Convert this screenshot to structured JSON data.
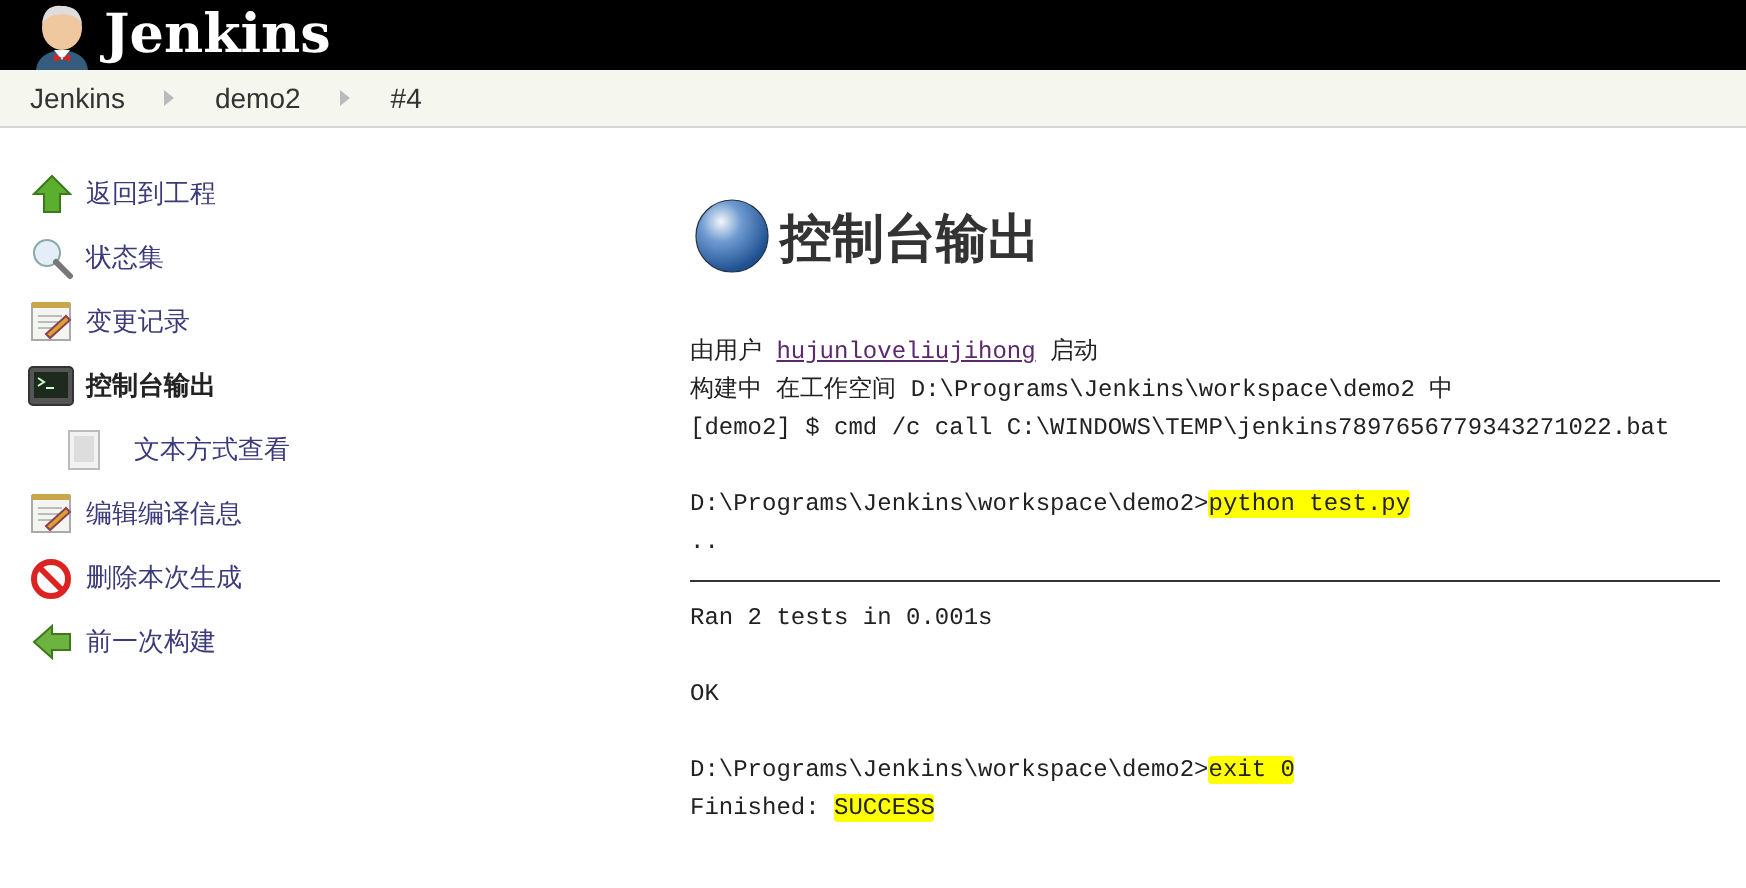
{
  "header": {
    "title": "Jenkins"
  },
  "breadcrumbs": [
    {
      "label": "Jenkins"
    },
    {
      "label": "demo2"
    },
    {
      "label": "#4"
    }
  ],
  "sidebar": {
    "items": [
      {
        "label": "返回到工程",
        "kind": "up",
        "selected": false
      },
      {
        "label": "状态集",
        "kind": "search",
        "selected": false
      },
      {
        "label": "变更记录",
        "kind": "notepad",
        "selected": false
      },
      {
        "label": "控制台输出",
        "kind": "terminal",
        "selected": true,
        "children": [
          {
            "label": "文本方式查看",
            "kind": "document",
            "selected": false
          }
        ]
      },
      {
        "label": "编辑编译信息",
        "kind": "notepad",
        "selected": false
      },
      {
        "label": "删除本次生成",
        "kind": "delete",
        "selected": false
      },
      {
        "label": "前一次构建",
        "kind": "back",
        "selected": false
      }
    ]
  },
  "heading": "控制台输出",
  "console": [
    {
      "kind": "text",
      "segments": [
        {
          "text": "由用户 ",
          "kind": "plain"
        },
        {
          "text": "hujunloveliujihong",
          "kind": "link"
        },
        {
          "text": " 启动",
          "kind": "plain"
        }
      ]
    },
    {
      "kind": "text",
      "segments": [
        {
          "text": "构建中 在工作空间 D:\\Programs\\Jenkins\\workspace\\demo2 中",
          "kind": "plain"
        }
      ]
    },
    {
      "kind": "text",
      "segments": [
        {
          "text": "[demo2] $ cmd /c call C:\\WINDOWS\\TEMP\\jenkins7897656779343271022.bat",
          "kind": "plain"
        }
      ]
    },
    {
      "kind": "blank"
    },
    {
      "kind": "text",
      "segments": [
        {
          "text": "D:\\Programs\\Jenkins\\workspace\\demo2>",
          "kind": "plain"
        },
        {
          "text": "python test.py",
          "kind": "highlight"
        }
      ]
    },
    {
      "kind": "text",
      "segments": [
        {
          "text": "..",
          "kind": "plain"
        }
      ]
    },
    {
      "kind": "rule"
    },
    {
      "kind": "text",
      "segments": [
        {
          "text": "Ran 2 tests in 0.001s",
          "kind": "plain"
        }
      ]
    },
    {
      "kind": "blank"
    },
    {
      "kind": "text",
      "segments": [
        {
          "text": "OK",
          "kind": "plain"
        }
      ]
    },
    {
      "kind": "blank"
    },
    {
      "kind": "text",
      "segments": [
        {
          "text": "D:\\Programs\\Jenkins\\workspace\\demo2>",
          "kind": "plain"
        },
        {
          "text": "exit 0",
          "kind": "highlight"
        }
      ]
    },
    {
      "kind": "text",
      "segments": [
        {
          "text": "Finished: ",
          "kind": "plain"
        },
        {
          "text": "SUCCESS",
          "kind": "highlight"
        }
      ]
    }
  ]
}
